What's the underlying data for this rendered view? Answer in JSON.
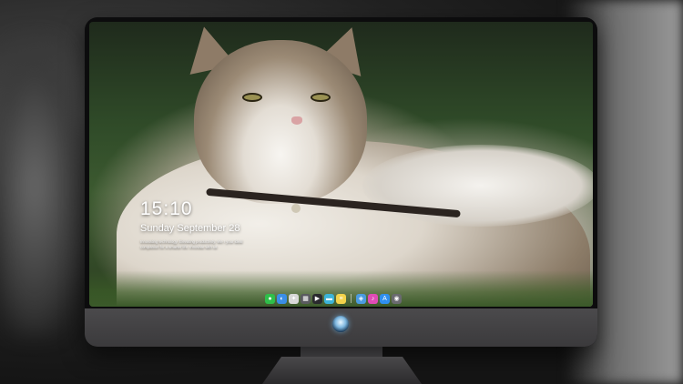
{
  "lock_screen": {
    "time": "15:10",
    "date": "Sunday September 28",
    "tagline": "Innovating technology. Elevating productivity. We r your ideal companion for a smarter life. Innovate with us"
  },
  "dock": {
    "items": [
      {
        "name": "messages-icon",
        "glyph": "●",
        "color": "#2fbf4a"
      },
      {
        "name": "finder-icon",
        "glyph": "◐",
        "color": "#3a8ee6"
      },
      {
        "name": "safari-icon",
        "glyph": "✦",
        "color": "#d8d8d8"
      },
      {
        "name": "launchpad-icon",
        "glyph": "▦",
        "color": "#5a5a60"
      },
      {
        "name": "finalcut-icon",
        "glyph": "▶",
        "color": "#2a2a2e"
      },
      {
        "name": "files-icon",
        "glyph": "▬",
        "color": "#3cb4d8"
      },
      {
        "name": "notes-icon",
        "glyph": "≡",
        "color": "#f2d24a"
      },
      {
        "name": "preview-icon",
        "glyph": "◈",
        "color": "#4b9be0"
      },
      {
        "name": "itunes-icon",
        "glyph": "♪",
        "color": "#e04bb5"
      },
      {
        "name": "appstore-icon",
        "glyph": "A",
        "color": "#2f8ff0"
      },
      {
        "name": "camera-icon",
        "glyph": "◉",
        "color": "#6a6a70"
      }
    ],
    "separator_after": 7
  }
}
